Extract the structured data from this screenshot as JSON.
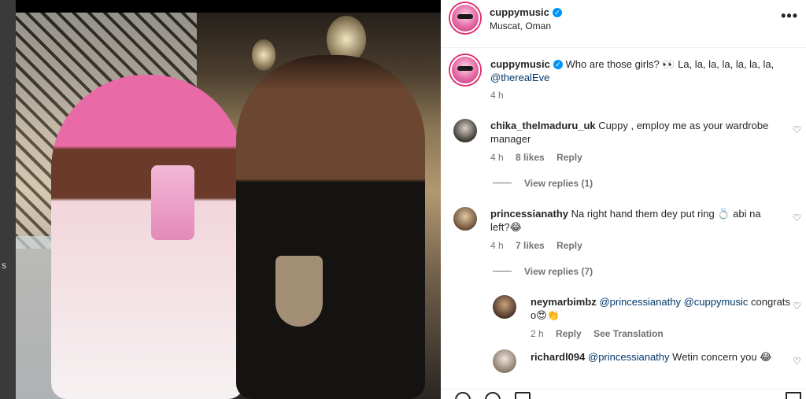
{
  "left_edge": {
    "fragment": "s"
  },
  "post": {
    "author": "cuppymusic",
    "location": "Muscat, Oman",
    "more_label": "•••",
    "caption": {
      "user": "cuppymusic",
      "text": "Who are those girls? 👀 La, la, la, la, la, la, la,",
      "mention": "@therealEve",
      "time": "4 h"
    }
  },
  "comments": [
    {
      "user": "chika_thelmaduru_uk",
      "text": "Cuppy , employ me as your wardrobe manager",
      "time": "4 h",
      "likes": "8 likes",
      "reply": "Reply",
      "view_replies": "View replies (1)"
    },
    {
      "user": "princessianathy",
      "text": "Na right hand them dey put ring 💍 abi na left?😂",
      "time": "4 h",
      "likes": "7 likes",
      "reply": "Reply",
      "view_replies": "View replies (7)"
    }
  ],
  "replies": [
    {
      "user": "neymarbimbz",
      "mention": "@princessianathy @cuppymusic",
      "text": "congrats o😍👏",
      "time": "2 h",
      "reply": "Reply",
      "translate": "See Translation"
    },
    {
      "user": "richardl094",
      "mention": "@princessianathy",
      "text": "Wetin concern you 😂"
    }
  ],
  "icons": {
    "verified": "verified-badge-icon",
    "heart": "heart-icon",
    "more": "more-options-icon"
  },
  "colors": {
    "mention": "#00376b",
    "verified": "#0095f6",
    "meta": "#737373",
    "text": "#262626"
  }
}
